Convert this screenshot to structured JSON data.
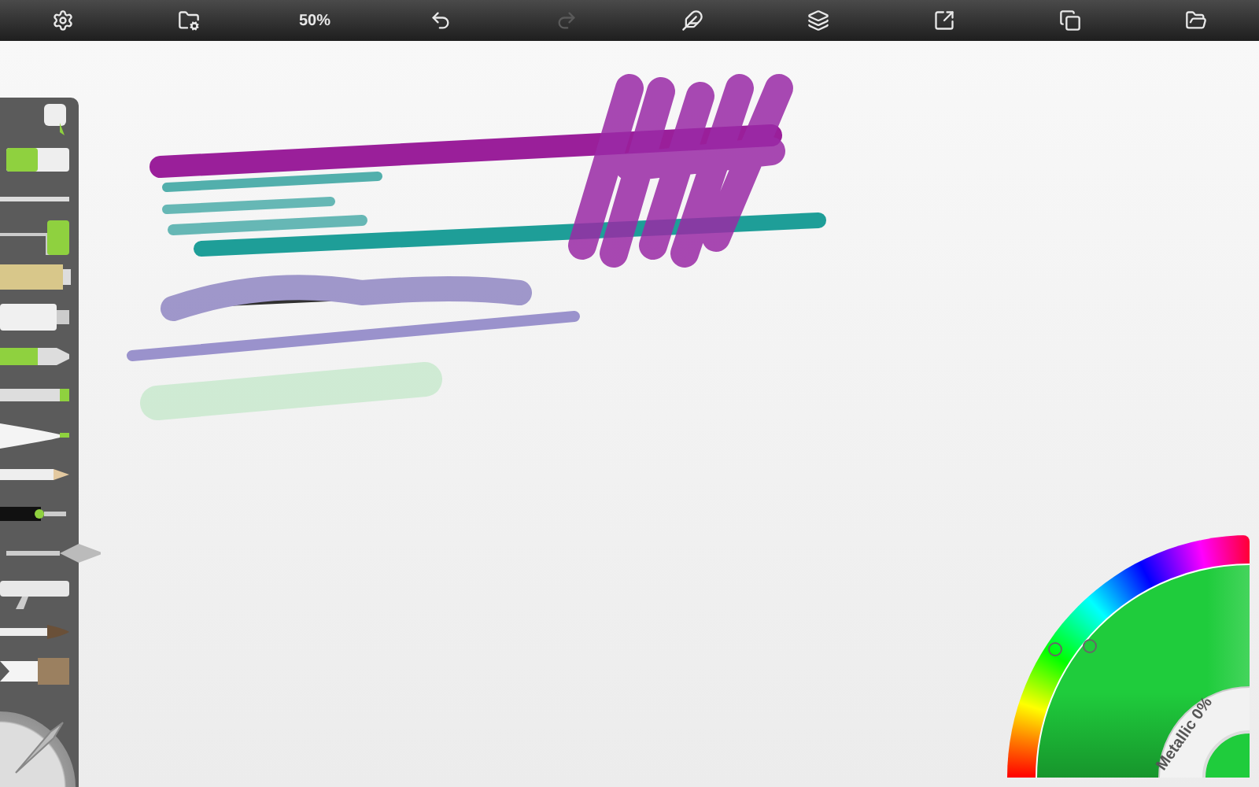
{
  "toolbar": [
    {
      "kind": "settings",
      "disabled": false
    },
    {
      "kind": "gallery",
      "disabled": false
    },
    {
      "kind": "zoom",
      "text": "50%",
      "disabled": false
    },
    {
      "kind": "undo",
      "disabled": false
    },
    {
      "kind": "redo",
      "disabled": true
    },
    {
      "kind": "reference",
      "disabled": false
    },
    {
      "kind": "layers",
      "disabled": false
    },
    {
      "kind": "export",
      "disabled": false
    },
    {
      "kind": "canvas",
      "disabled": false
    },
    {
      "kind": "menu",
      "disabled": false
    }
  ],
  "tools": [
    {
      "kind": "bucket",
      "selected": false
    },
    {
      "kind": "eraser",
      "selected": false
    },
    {
      "kind": "stick",
      "selected": false
    },
    {
      "kind": "roller",
      "selected": false
    },
    {
      "kind": "glitter",
      "selected": false
    },
    {
      "kind": "tube",
      "selected": false
    },
    {
      "kind": "marker",
      "selected": false
    },
    {
      "kind": "chalk",
      "selected": false
    },
    {
      "kind": "felt",
      "selected": false
    },
    {
      "kind": "pencil",
      "selected": false
    },
    {
      "kind": "pen",
      "selected": false
    },
    {
      "kind": "knife",
      "selected": true
    },
    {
      "kind": "airbrush",
      "selected": false
    },
    {
      "kind": "brush",
      "selected": false
    },
    {
      "kind": "flat",
      "selected": false
    }
  ],
  "color_picker": {
    "color": "#1fcc3c",
    "metallic_label": "Metallic 0%"
  }
}
